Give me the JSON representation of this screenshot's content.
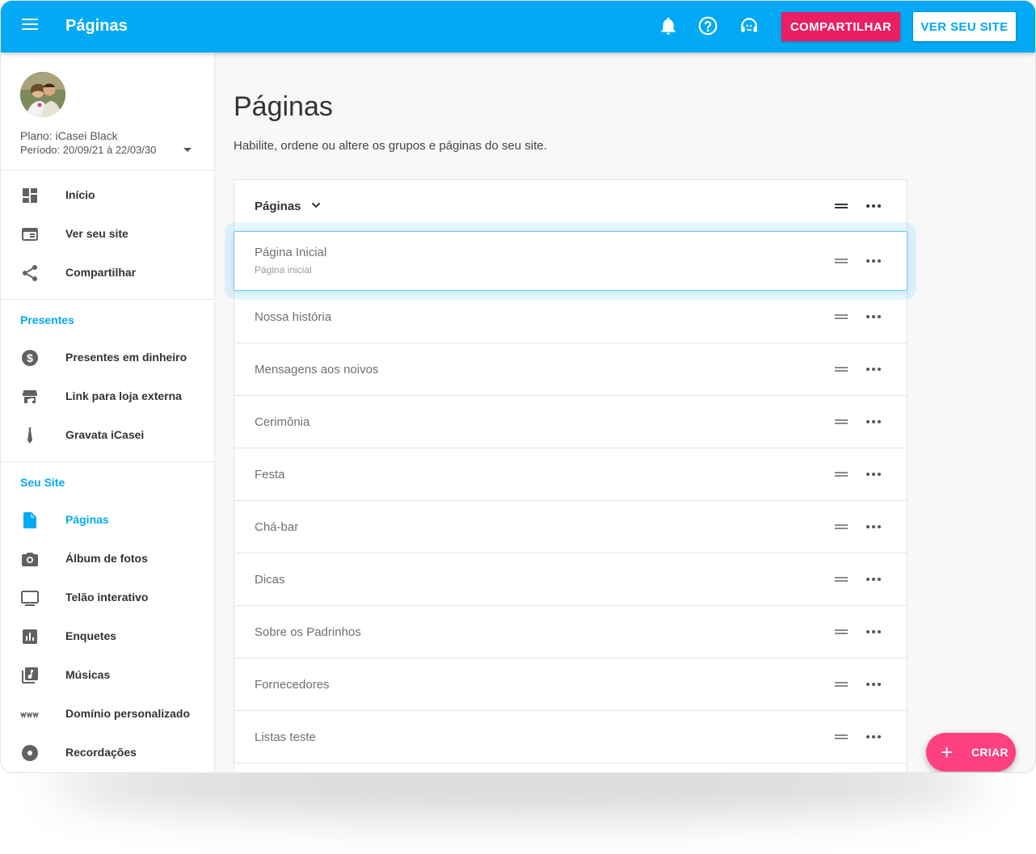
{
  "topbar": {
    "title": "Páginas",
    "share_label": "COMPARTILHAR",
    "view_site_label": "VER SEU SITE",
    "color": "#03a9f4",
    "icons": [
      "menu-icon",
      "bell-icon",
      "help-icon",
      "support-icon"
    ]
  },
  "sidebar": {
    "plan": "Plano: iCasei Black",
    "period": "Período: 20/09/21 à 22/03/30",
    "main_items": [
      {
        "label": "Início",
        "icon": "dashboard-icon"
      },
      {
        "label": "Ver seu site",
        "icon": "web-icon"
      },
      {
        "label": "Compartilhar",
        "icon": "share-icon"
      }
    ],
    "presentes_title": "Presentes",
    "presentes_items": [
      {
        "label": "Presentes em dinheiro",
        "icon": "money-icon"
      },
      {
        "label": "Link para loja externa",
        "icon": "store-icon"
      },
      {
        "label": "Gravata iCasei",
        "icon": "tie-icon"
      }
    ],
    "site_title": "Seu Site",
    "site_items": [
      {
        "label": "Páginas",
        "icon": "page-icon",
        "active": true
      },
      {
        "label": "Álbum de fotos",
        "icon": "camera-icon"
      },
      {
        "label": "Telão interativo",
        "icon": "screen-icon"
      },
      {
        "label": "Enquetes",
        "icon": "poll-icon"
      },
      {
        "label": "Músicas",
        "icon": "music-icon"
      },
      {
        "label": "Domínio personalizado",
        "icon": "www-icon"
      },
      {
        "label": "Recordações",
        "icon": "disc-icon"
      }
    ]
  },
  "main": {
    "title": "Páginas",
    "subtitle": "Habilite, ordene ou altere os grupos e páginas do seu site.",
    "group_label": "Páginas",
    "first_page": {
      "label": "Página Inicial",
      "sublabel": "Página inicial"
    },
    "pages": [
      "Nossa história",
      "Mensagens aos noivos",
      "Cerimônia",
      "Festa",
      "Chá-bar",
      "Dicas",
      "Sobre os Padrinhos",
      "Fornecedores",
      "Listas teste"
    ]
  },
  "fab": {
    "label": "CRIAR",
    "color": "#ff4081"
  },
  "colors": {
    "accent": "#03a9f4",
    "share": "#e91e63",
    "fab": "#ff4081"
  }
}
